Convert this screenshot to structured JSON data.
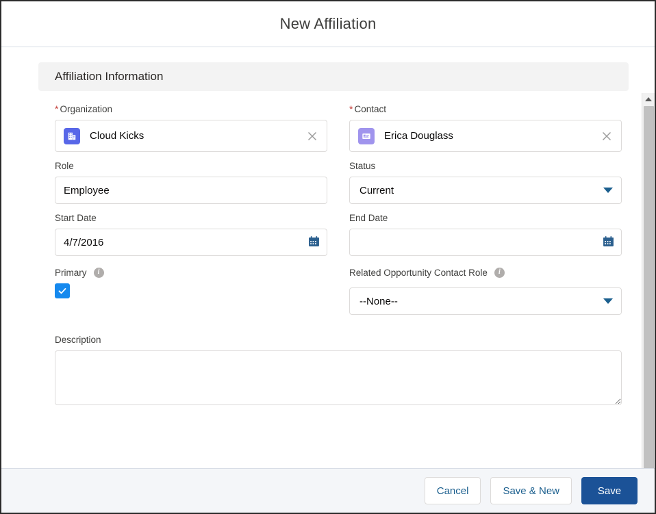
{
  "modal": {
    "title": "New Affiliation"
  },
  "section": {
    "title": "Affiliation Information"
  },
  "fields": {
    "organization": {
      "label": "Organization",
      "required_marker": "*",
      "value": "Cloud Kicks",
      "icon": "account-building-icon",
      "icon_color": "#5867e8",
      "clear_icon": "close-icon"
    },
    "contact": {
      "label": "Contact",
      "required_marker": "*",
      "value": "Erica Douglass",
      "icon": "contact-card-icon",
      "icon_color": "#a094ed",
      "clear_icon": "close-icon"
    },
    "role": {
      "label": "Role",
      "value": "Employee",
      "placeholder": ""
    },
    "status": {
      "label": "Status",
      "value": "Current",
      "icon": "chevron-down-icon"
    },
    "start_date": {
      "label": "Start Date",
      "value": "4/7/2016",
      "icon": "calendar-icon"
    },
    "end_date": {
      "label": "End Date",
      "value": "",
      "placeholder": "",
      "icon": "calendar-icon"
    },
    "primary": {
      "label": "Primary",
      "checked": true,
      "info_icon": "info-icon",
      "info_glyph": "i",
      "check_glyph": "✓",
      "checkbox_color": "#1589ee"
    },
    "related_opportunity_contact_role": {
      "label": "Related Opportunity Contact Role",
      "value": "--None--",
      "info_icon": "info-icon",
      "info_glyph": "i",
      "icon": "chevron-down-icon"
    },
    "description": {
      "label": "Description",
      "value": "",
      "placeholder": ""
    }
  },
  "footer": {
    "cancel_label": "Cancel",
    "save_new_label": "Save & New",
    "save_label": "Save",
    "brand_color": "#1b5297",
    "link_color": "#1b5f8e"
  },
  "scrollbar": {
    "up_icon": "caret-up-icon",
    "down_icon": "caret-down-icon"
  }
}
